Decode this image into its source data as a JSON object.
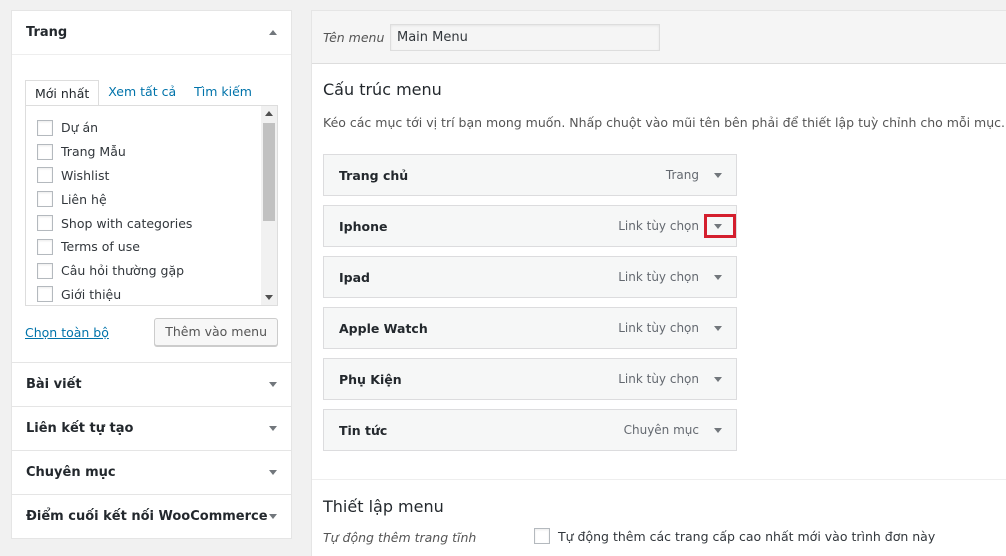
{
  "pages_box": {
    "title": "Trang",
    "tabs": [
      "Mới nhất",
      "Xem tất cả",
      "Tìm kiếm"
    ],
    "items": [
      "Dự án",
      "Trang Mẫu",
      "Wishlist",
      "Liên hệ",
      "Shop with categories",
      "Terms of use",
      "Câu hỏi thường gặp",
      "Giới thiệu"
    ],
    "select_all": "Chọn toàn bộ",
    "add_button": "Thêm vào menu"
  },
  "accordion": {
    "posts": "Bài viết",
    "custom_links": "Liên kết tự tạo",
    "categories": "Chuyên mục",
    "woo_endpoints": "Điểm cuối kết nối WooCommerce"
  },
  "menu_editor": {
    "name_label": "Tên menu",
    "name_value": "Main Menu",
    "structure_title": "Cấu trúc menu",
    "structure_desc": "Kéo các mục tới vị trí bạn mong muốn. Nhấp chuột vào mũi tên bên phải để thiết lập tuỳ chỉnh cho mỗi mục.",
    "items": [
      {
        "title": "Trang chủ",
        "type": "Trang"
      },
      {
        "title": "Iphone",
        "type": "Link tùy chọn"
      },
      {
        "title": "Ipad",
        "type": "Link tùy chọn"
      },
      {
        "title": "Apple Watch",
        "type": "Link tùy chọn"
      },
      {
        "title": "Phụ Kiện",
        "type": "Link tùy chọn"
      },
      {
        "title": "Tin tức",
        "type": "Chuyên mục"
      }
    ],
    "settings_title": "Thiết lập menu",
    "auto_add_label": "Tự động thêm trang tĩnh",
    "auto_add_option": "Tự động thêm các trang cấp cao nhất mới vào trình đơn này"
  },
  "colors": {
    "link": "#0073aa",
    "highlight": "#d41f2e"
  }
}
